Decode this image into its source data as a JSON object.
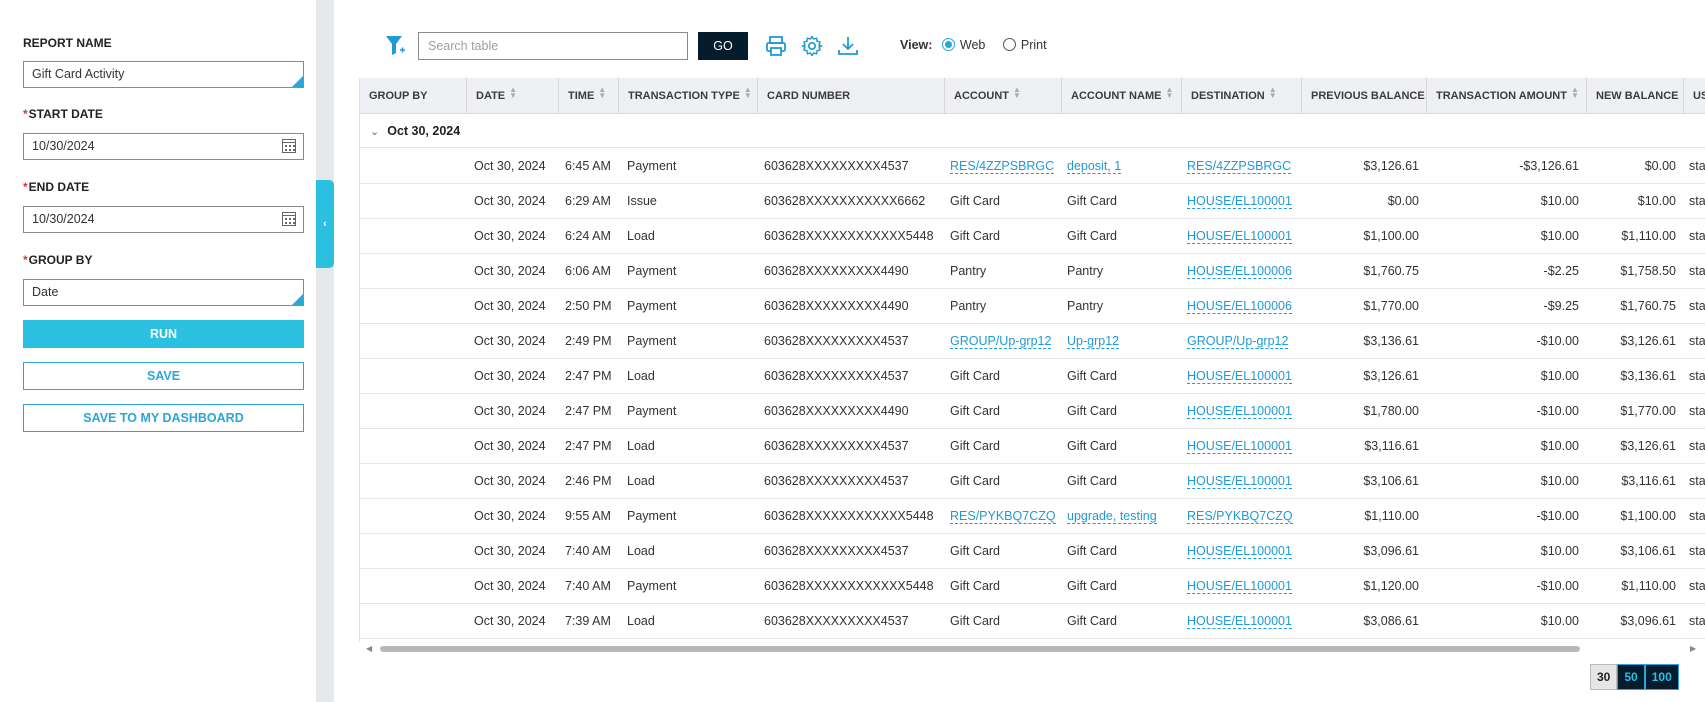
{
  "sidebar": {
    "report_name_label": "REPORT NAME",
    "report_name_value": "Gift Card Activity",
    "start_date_label": "START DATE",
    "start_date_value": "10/30/2024",
    "end_date_label": "END DATE",
    "end_date_value": "10/30/2024",
    "group_by_label": "GROUP BY",
    "group_by_value": "Date",
    "required_mark": "*",
    "run_label": "RUN",
    "save_label": "SAVE",
    "save_dashboard_label": "SAVE TO MY DASHBOARD",
    "collapse_glyph": "‹"
  },
  "toolbar": {
    "search_placeholder": "Search table",
    "go_label": "GO",
    "view_label": "View:",
    "view_options": [
      "Web",
      "Print"
    ],
    "view_selected": "Web",
    "icons": [
      "filter-add-icon",
      "print-icon",
      "settings-icon",
      "download-icon"
    ]
  },
  "table": {
    "columns": [
      "GROUP BY",
      "DATE",
      "TIME",
      "TRANSACTION TYPE",
      "CARD NUMBER",
      "ACCOUNT",
      "ACCOUNT NAME",
      "DESTINATION",
      "PREVIOUS BALANCE",
      "TRANSACTION AMOUNT",
      "NEW BALANCE",
      "US"
    ],
    "group_label": "Oct 30, 2024",
    "rows": [
      {
        "date": "Oct 30, 2024",
        "time": "6:45 AM",
        "type": "Payment",
        "card": "603628XXXXXXXXX4537",
        "account": "RES/4ZZPSBRGC",
        "account_link": true,
        "account_name": "deposit, 1",
        "name_link": true,
        "destination": "RES/4ZZPSBRGC",
        "prev": "$3,126.61",
        "amount": "-$3,126.61",
        "new": "$0.00",
        "user": "sta"
      },
      {
        "date": "Oct 30, 2024",
        "time": "6:29 AM",
        "type": "Issue",
        "card": "603628XXXXXXXXXXX6662",
        "account": "Gift Card",
        "account_link": false,
        "account_name": "Gift Card",
        "name_link": false,
        "destination": "HOUSE/EL100001",
        "prev": "$0.00",
        "amount": "$10.00",
        "new": "$10.00",
        "user": "sta"
      },
      {
        "date": "Oct 30, 2024",
        "time": "6:24 AM",
        "type": "Load",
        "card": "603628XXXXXXXXXXXX5448",
        "account": "Gift Card",
        "account_link": false,
        "account_name": "Gift Card",
        "name_link": false,
        "destination": "HOUSE/EL100001",
        "prev": "$1,100.00",
        "amount": "$10.00",
        "new": "$1,110.00",
        "user": "sta"
      },
      {
        "date": "Oct 30, 2024",
        "time": "6:06 AM",
        "type": "Payment",
        "card": "603628XXXXXXXXX4490",
        "account": "Pantry",
        "account_link": false,
        "account_name": "Pantry",
        "name_link": false,
        "destination": "HOUSE/EL100006",
        "prev": "$1,760.75",
        "amount": "-$2.25",
        "new": "$1,758.50",
        "user": "sta"
      },
      {
        "date": "Oct 30, 2024",
        "time": "2:50 PM",
        "type": "Payment",
        "card": "603628XXXXXXXXX4490",
        "account": "Pantry",
        "account_link": false,
        "account_name": "Pantry",
        "name_link": false,
        "destination": "HOUSE/EL100006",
        "prev": "$1,770.00",
        "amount": "-$9.25",
        "new": "$1,760.75",
        "user": "sta"
      },
      {
        "date": "Oct 30, 2024",
        "time": "2:49 PM",
        "type": "Payment",
        "card": "603628XXXXXXXXX4537",
        "account": "GROUP/Up-grp12",
        "account_link": true,
        "account_name": "Up-grp12",
        "name_link": true,
        "destination": "GROUP/Up-grp12",
        "prev": "$3,136.61",
        "amount": "-$10.00",
        "new": "$3,126.61",
        "user": "sta"
      },
      {
        "date": "Oct 30, 2024",
        "time": "2:47 PM",
        "type": "Load",
        "card": "603628XXXXXXXXX4537",
        "account": "Gift Card",
        "account_link": false,
        "account_name": "Gift Card",
        "name_link": false,
        "destination": "HOUSE/EL100001",
        "prev": "$3,126.61",
        "amount": "$10.00",
        "new": "$3,136.61",
        "user": "sta"
      },
      {
        "date": "Oct 30, 2024",
        "time": "2:47 PM",
        "type": "Payment",
        "card": "603628XXXXXXXXX4490",
        "account": "Gift Card",
        "account_link": false,
        "account_name": "Gift Card",
        "name_link": false,
        "destination": "HOUSE/EL100001",
        "prev": "$1,780.00",
        "amount": "-$10.00",
        "new": "$1,770.00",
        "user": "sta"
      },
      {
        "date": "Oct 30, 2024",
        "time": "2:47 PM",
        "type": "Load",
        "card": "603628XXXXXXXXX4537",
        "account": "Gift Card",
        "account_link": false,
        "account_name": "Gift Card",
        "name_link": false,
        "destination": "HOUSE/EL100001",
        "prev": "$3,116.61",
        "amount": "$10.00",
        "new": "$3,126.61",
        "user": "sta"
      },
      {
        "date": "Oct 30, 2024",
        "time": "2:46 PM",
        "type": "Load",
        "card": "603628XXXXXXXXX4537",
        "account": "Gift Card",
        "account_link": false,
        "account_name": "Gift Card",
        "name_link": false,
        "destination": "HOUSE/EL100001",
        "prev": "$3,106.61",
        "amount": "$10.00",
        "new": "$3,116.61",
        "user": "sta"
      },
      {
        "date": "Oct 30, 2024",
        "time": "9:55 AM",
        "type": "Payment",
        "card": "603628XXXXXXXXXXXX5448",
        "account": "RES/PYKBQ7CZQ",
        "account_link": true,
        "account_name": "upgrade, testing",
        "name_link": true,
        "destination": "RES/PYKBQ7CZQ",
        "prev": "$1,110.00",
        "amount": "-$10.00",
        "new": "$1,100.00",
        "user": "sta"
      },
      {
        "date": "Oct 30, 2024",
        "time": "7:40 AM",
        "type": "Load",
        "card": "603628XXXXXXXXX4537",
        "account": "Gift Card",
        "account_link": false,
        "account_name": "Gift Card",
        "name_link": false,
        "destination": "HOUSE/EL100001",
        "prev": "$3,096.61",
        "amount": "$10.00",
        "new": "$3,106.61",
        "user": "sta"
      },
      {
        "date": "Oct 30, 2024",
        "time": "7:40 AM",
        "type": "Payment",
        "card": "603628XXXXXXXXXXXX5448",
        "account": "Gift Card",
        "account_link": false,
        "account_name": "Gift Card",
        "name_link": false,
        "destination": "HOUSE/EL100001",
        "prev": "$1,120.00",
        "amount": "-$10.00",
        "new": "$1,110.00",
        "user": "sta"
      },
      {
        "date": "Oct 30, 2024",
        "time": "7:39 AM",
        "type": "Load",
        "card": "603628XXXXXXXXX4537",
        "account": "Gift Card",
        "account_link": false,
        "account_name": "Gift Card",
        "name_link": false,
        "destination": "HOUSE/EL100001",
        "prev": "$3,086.61",
        "amount": "$10.00",
        "new": "$3,096.61",
        "user": "sta"
      }
    ]
  },
  "pager": {
    "options": [
      "30",
      "50",
      "100"
    ],
    "selected": "30"
  },
  "colors": {
    "accent": "#2bbfe0",
    "link": "#1f9ad6",
    "dark": "#051c2c"
  }
}
